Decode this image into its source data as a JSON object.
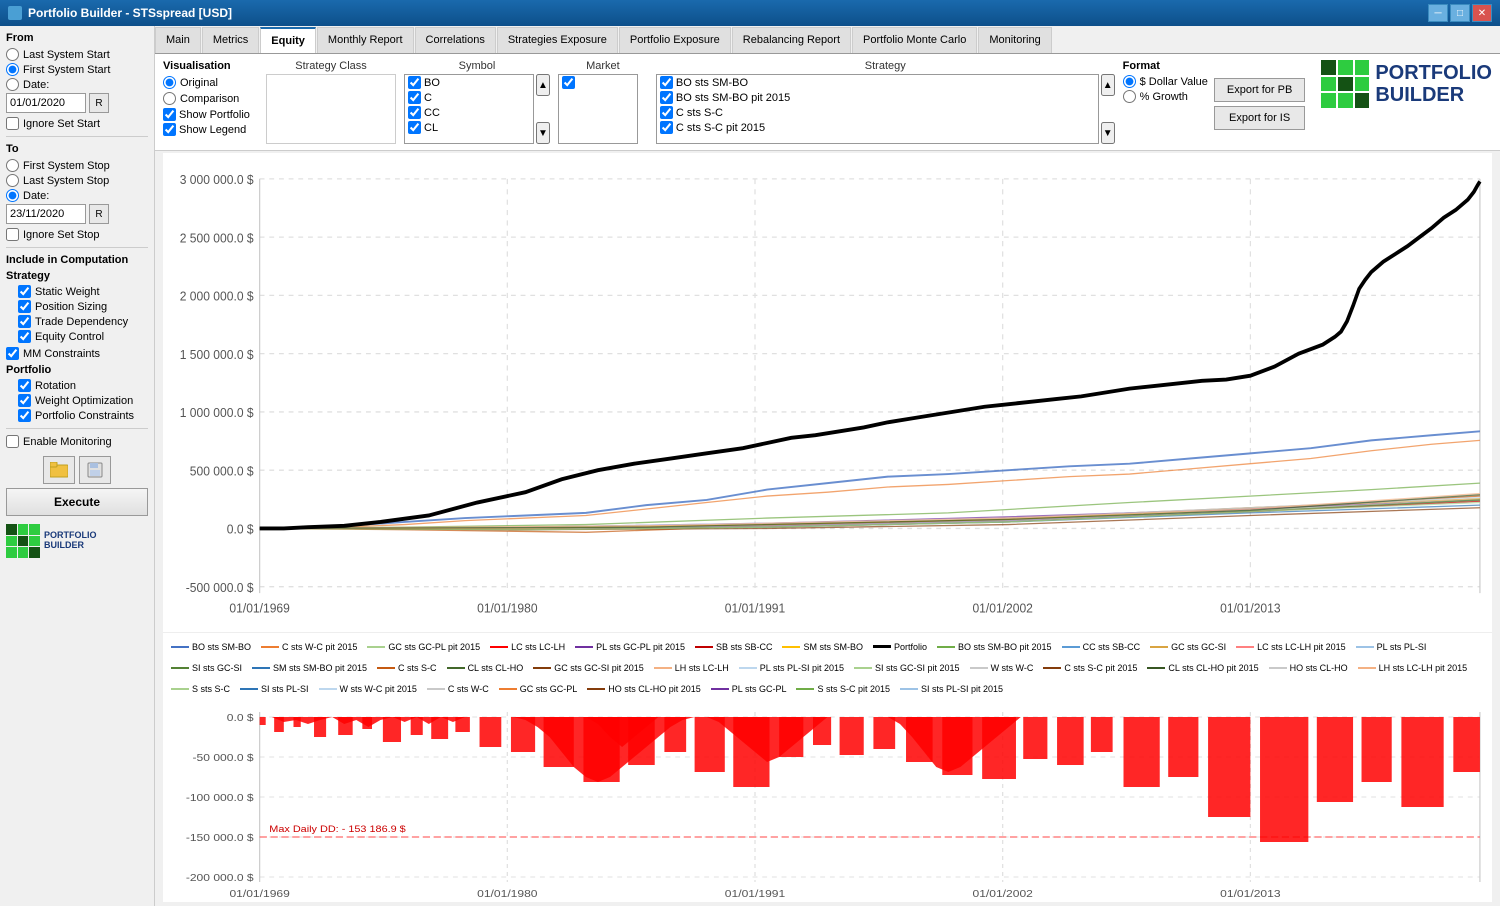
{
  "window": {
    "title": "Portfolio Builder - STSspread [USD]",
    "icon": "portfolio-icon"
  },
  "tabs": [
    {
      "id": "main",
      "label": "Main",
      "active": false
    },
    {
      "id": "metrics",
      "label": "Metrics",
      "active": false
    },
    {
      "id": "equity",
      "label": "Equity",
      "active": true
    },
    {
      "id": "monthly-report",
      "label": "Monthly Report",
      "active": false
    },
    {
      "id": "correlations",
      "label": "Correlations",
      "active": false
    },
    {
      "id": "strategies-exposure",
      "label": "Strategies Exposure",
      "active": false
    },
    {
      "id": "portfolio-exposure",
      "label": "Portfolio Exposure",
      "active": false
    },
    {
      "id": "rebalancing-report",
      "label": "Rebalancing Report",
      "active": false
    },
    {
      "id": "portfolio-monte-carlo",
      "label": "Portfolio Monte Carlo",
      "active": false
    },
    {
      "id": "monitoring",
      "label": "Monitoring",
      "active": false
    }
  ],
  "left_panel": {
    "from_label": "From",
    "from_options": [
      "Last System Start",
      "First System Start",
      "Date:"
    ],
    "from_date": "01/01/2020",
    "ignore_set_start": "Ignore Set Start",
    "to_label": "To",
    "to_options": [
      "First System Stop",
      "Last System Stop",
      "Date:"
    ],
    "to_date": "23/11/2020",
    "ignore_set_stop": "Ignore Set Stop",
    "include_computation_label": "Include in Computation",
    "strategy_label": "Strategy",
    "static_weight": "Static Weight",
    "position_sizing": "Position Sizing",
    "trade_dependency": "Trade Dependency",
    "equity_control": "Equity Control",
    "mm_constraints": "MM Constraints",
    "portfolio_label": "Portfolio",
    "rotation": "Rotation",
    "weight_optimization": "Weight Optimization",
    "portfolio_constraints": "Portfolio Constraints",
    "enable_monitoring": "Enable Monitoring",
    "execute_label": "Execute"
  },
  "visualization": {
    "label": "Visualisation",
    "original": "Original",
    "comparison": "Comparison",
    "show_portfolio": "Show Portfolio",
    "show_legend": "Show Legend",
    "strategy_class_label": "Strategy Class",
    "symbol_label": "Symbol",
    "market_label": "Market",
    "strategy_label": "Strategy",
    "symbols": [
      "BO",
      "C",
      "CC",
      "CL"
    ],
    "market_checked": [
      ""
    ],
    "strategies": [
      "BO sts SM-BO",
      "BO sts SM-BO pit 2015",
      "C sts S-C",
      "C sts S-C pit 2015"
    ],
    "format_label": "Format",
    "dollar_value": "$ Dollar Value",
    "pct_growth": "% Growth",
    "export_pb": "Export for PB",
    "export_is": "Export for IS"
  },
  "legend": {
    "items": [
      {
        "label": "BO sts SM-BO",
        "color": "#4472c4"
      },
      {
        "label": "C sts W-C pit 2015",
        "color": "#ed7d31"
      },
      {
        "label": "GC sts GC-PL pit 2015",
        "color": "#a9d18e"
      },
      {
        "label": "LC sts LC-LH",
        "color": "#ff0000"
      },
      {
        "label": "PL sts GC-PL pit 2015",
        "color": "#7030a0"
      },
      {
        "label": "SB sts SB-CC",
        "color": "#c00000"
      },
      {
        "label": "SM sts SM-BO",
        "color": "#ffc000"
      },
      {
        "label": "Portfolio",
        "color": "#000000"
      },
      {
        "label": "BO sts SM-BO pit 2015",
        "color": "#70ad47"
      },
      {
        "label": "CC sts SB-CC",
        "color": "#5b9bd5"
      },
      {
        "label": "GC sts GC-SI",
        "color": "#d9a441"
      },
      {
        "label": "LC sts LC-LH pit 2015",
        "color": "#ff8080"
      },
      {
        "label": "PL sts PL-SI",
        "color": "#9dc3e6"
      },
      {
        "label": "SI sts GC-SI",
        "color": "#548235"
      },
      {
        "label": "SM sts SM-BO pit 2015",
        "color": "#2e75b6"
      },
      {
        "label": "C sts S-C",
        "color": "#c55a11"
      },
      {
        "label": "CL sts CL-HO",
        "color": "#43682b"
      },
      {
        "label": "GC sts GC-SI pit 2015",
        "color": "#833c0b"
      },
      {
        "label": "LH sts LC-LH",
        "color": "#f4b183"
      },
      {
        "label": "PL sts PL-SI pit 2015",
        "color": "#bdd7ee"
      },
      {
        "label": "SI sts GC-SI pit 2015",
        "color": "#a9d18e"
      },
      {
        "label": "W sts W-C",
        "color": "#c9c9c9"
      },
      {
        "label": "C sts S-C pit 2015",
        "color": "#843c0c"
      },
      {
        "label": "CL sts CL-HO pit 2015",
        "color": "#375623"
      },
      {
        "label": "HO sts CL-HO",
        "color": "#c9c9c9"
      },
      {
        "label": "LH sts LC-LH pit 2015",
        "color": "#f4b183"
      },
      {
        "label": "S sts S-C",
        "color": "#a9d18e"
      },
      {
        "label": "SI sts PL-SI",
        "color": "#2e75b6"
      },
      {
        "label": "W sts W-C pit 2015",
        "color": "#bdd7ee"
      },
      {
        "label": "C sts W-C",
        "color": "#c9c9c9"
      },
      {
        "label": "GC sts GC-PL",
        "color": "#ed7d31"
      },
      {
        "label": "HO sts CL-HO pit 2015",
        "color": "#843c0c"
      },
      {
        "label": "PL sts GC-PL",
        "color": "#7030a0"
      },
      {
        "label": "S sts S-C pit 2015",
        "color": "#70ad47"
      },
      {
        "label": "SI sts PL-SI pit 2015",
        "color": "#9dc3e6"
      }
    ]
  },
  "chart": {
    "y_labels_main": [
      "3 000 000.0 $",
      "2 500 000.0 $",
      "2 000 000.0 $",
      "1 500 000.0 $",
      "1 000 000.0 $",
      "500 000.0 $",
      "0.0 $",
      "-500 000.0 $"
    ],
    "x_labels": [
      "01/01/1969",
      "01/01/1980",
      "01/01/1991",
      "01/01/2002",
      "01/01/2013"
    ],
    "y_labels_dd": [
      "0.0 $",
      "-50 000.0 $",
      "-100 000.0 $",
      "-150 000.0 $",
      "-200 000.0 $"
    ],
    "max_dd_label": "Max Daily DD: - 153 186.9 $"
  }
}
